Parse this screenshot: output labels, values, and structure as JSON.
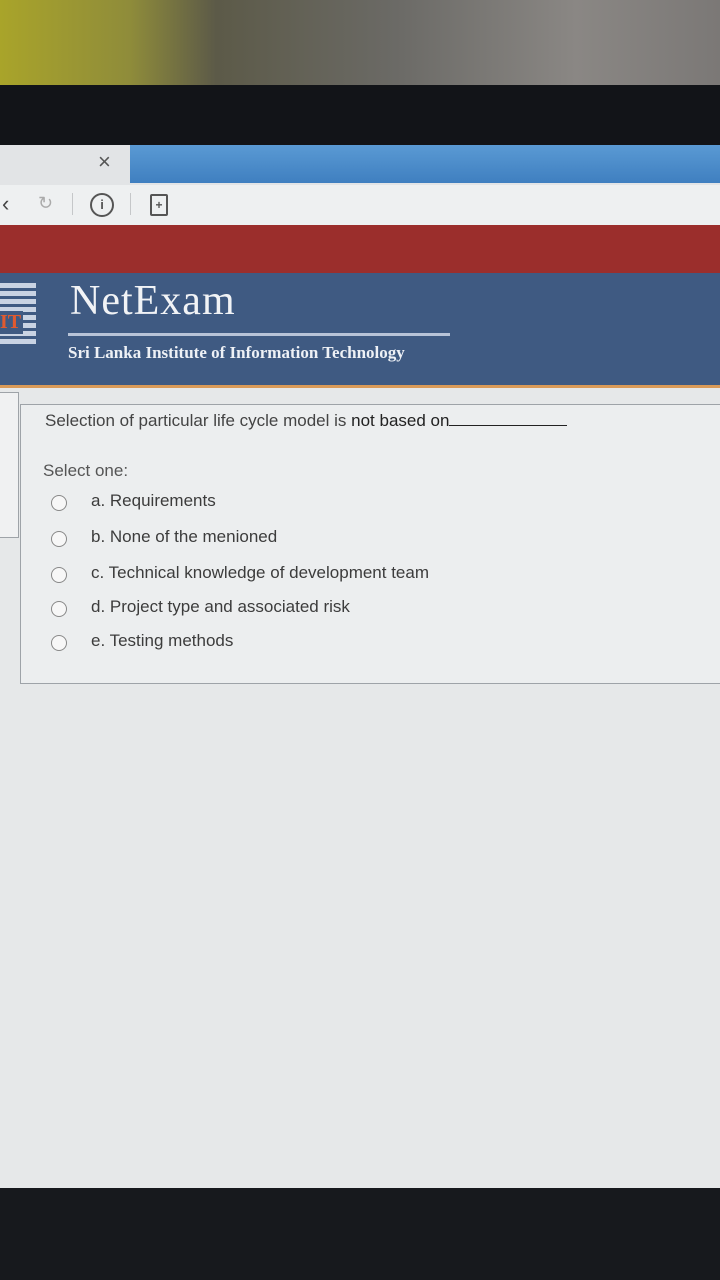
{
  "browser": {
    "close_glyph": "×",
    "back_glyph": "‹",
    "reload_glyph": "↻",
    "info_glyph": "i",
    "page_glyph": "+"
  },
  "header": {
    "logo_text": "IT",
    "brand": "NetExam",
    "institute": "Sri Lanka Institute of Information Technology"
  },
  "question": {
    "text_start": "Selection of particular life cycle model is ",
    "text_emphasis": "not based on",
    "select_label": "Select one:",
    "options": [
      {
        "label": "a. Requirements"
      },
      {
        "label": "b. None of the menioned"
      },
      {
        "label": "c. Technical knowledge of development team"
      },
      {
        "label": "d. Project type and associated risk"
      },
      {
        "label": "e. Testing methods"
      }
    ]
  },
  "colors": {
    "header_blue": "#3f5a82",
    "red_band": "#9b2e2c",
    "tab_blue": "#4a8cca",
    "accent_orange": "#d99a58"
  }
}
